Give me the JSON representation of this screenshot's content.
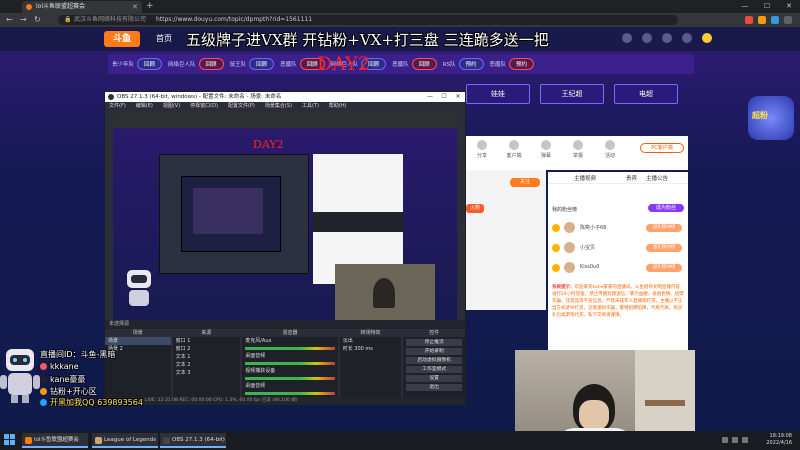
{
  "browser": {
    "tab_title": "lol斗鱼联盟超赛会",
    "url_site": "武汉斗鱼网络科技有限公司",
    "url": "https://www.douyu.com/topic/dpmpth?rid=1561111"
  },
  "site": {
    "logo": "斗鱼",
    "home": "首页",
    "title_overlay": "五级牌子进VX群 开钻粉+VX+打三盘 三连跪多送一把",
    "day_overlay": "DAY2"
  },
  "teams": {
    "row": [
      {
        "name": "贵少年队",
        "btn": "回顾",
        "red": false
      },
      {
        "name": "网络巨人队",
        "btn": "回顾",
        "red": true
      },
      {
        "name": "鼠王队",
        "btn": "回顾",
        "red": false
      },
      {
        "name": "恶魔队",
        "btn": "回顾",
        "red": true
      },
      {
        "name": "网络巨人队",
        "btn": "回顾",
        "red": false
      },
      {
        "name": "恶魔队",
        "btn": "回顾",
        "red": true
      },
      {
        "name": "RS队",
        "btn": "预约",
        "red": false
      },
      {
        "name": "恶魔队",
        "btn": "预约",
        "red": true
      }
    ],
    "blocks": [
      "娃娃",
      "王纪超",
      "电超"
    ]
  },
  "right_panel": {
    "gifts": [
      "分享",
      "客户端",
      "弹幕",
      "举报",
      "活动"
    ],
    "pc_btn": "PC客户端",
    "follow": "关注",
    "fire": "火箭",
    "tabs": [
      "主播视频",
      "贵宾",
      "主播公告"
    ],
    "sub": "我的粉丝榜",
    "pill": "成为粉丝",
    "ranks": [
      {
        "name": "陈奕小子68",
        "pill": "送礼物冲榜"
      },
      {
        "name": "小宝贝",
        "pill": "送礼物冲榜"
      },
      {
        "name": "Kiss0u0",
        "pill": "送礼物冲榜"
      }
    ],
    "notice_lead": "系统提示：",
    "notice": "欢迎来到kane豪豪的直播间。斗鱼倡导文明直播内容进行24小时巡查，禁止传播封建迷信、暴力血腥、低俗色情、招嫖诈骗、违禁品等不良信息，严禁未成年人直播或打赏，主播以不正当方式诱导打赏，注意谨防诈骗，警惕招聘陷阱，代练代刷，购买礼包类游戏代充，私下交易请谨慎。"
  },
  "obs": {
    "title": "OBS 27.1.3 (64-bit, windows) - 配置文件: 未命名 - 场景: 未命名",
    "menu": [
      "文件(F)",
      "编辑(E)",
      "视图(V)",
      "停靠窗口(D)",
      "配置文件(P)",
      "场景集合(S)",
      "工具(T)",
      "帮助(H)"
    ],
    "preview_day": "DAY2",
    "source_bar": "未选择源",
    "dock_scenes": "场景",
    "scenes": [
      "场景",
      "场景 2"
    ],
    "dock_sources": "来源",
    "sources": [
      "窗口 1",
      "窗口 2",
      "文本 1",
      "文本 2",
      "文本 3"
    ],
    "dock_mixer": "混音器",
    "mixer": [
      "麦克风/Aux",
      "桌面音频",
      "视频捕获设备",
      "桌面音频"
    ],
    "dock_transitions": "转场特效",
    "transition": "淡出",
    "duration_label": "时长",
    "duration": "300 ms",
    "dock_controls": "控件",
    "controls": [
      "停止推流",
      "开始录制",
      "启动虚拟摄像机",
      "工作室模式",
      "设置",
      "退出"
    ],
    "status": "LIVE: 12:31:08   REC: 00:00:00   CPU: 1.3%, 60.00 fps   已丢 (84,100 帧)"
  },
  "stream_overlay": {
    "lines": [
      "直播间ID：斗鱼-黑暗",
      "kkkane",
      "kane豪豪",
      "钻粉+开心区",
      "开黑加我QQ 639893564"
    ]
  },
  "mascot": {
    "text": "超粉"
  },
  "taskbar": {
    "tasks": [
      {
        "label": "lol斗鱼联盟超赛会",
        "color": "#f57b12"
      },
      {
        "label": "League of Legends",
        "color": "#c8aa6e"
      },
      {
        "label": "OBS 27.1.3 (64-bit)",
        "color": "#444"
      }
    ],
    "time": "18:19:08",
    "date": "2022/4/16"
  }
}
